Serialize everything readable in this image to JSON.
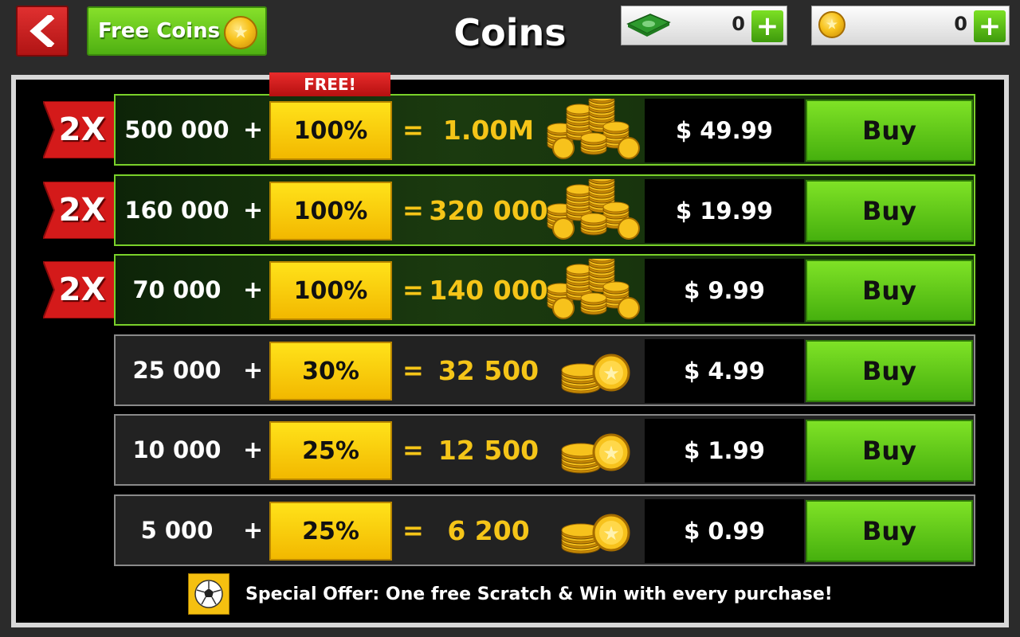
{
  "header": {
    "back_icon": "chevron-left-icon",
    "free_coins_label": "Free Coins",
    "title": "Coins",
    "cash_amount": "0",
    "coins_amount": "0",
    "plus_label": "+"
  },
  "free_tag": "FREE!",
  "packages": [
    {
      "badge": "2X",
      "base": "500 000",
      "plus": "+",
      "bonus": "100%",
      "eq": "=",
      "total": "1.00M",
      "price": "$ 49.99",
      "buy": "Buy",
      "promo": true
    },
    {
      "badge": "2X",
      "base": "160 000",
      "plus": "+",
      "bonus": "100%",
      "eq": "=",
      "total": "320 000",
      "price": "$ 19.99",
      "buy": "Buy",
      "promo": true
    },
    {
      "badge": "2X",
      "base": "70 000",
      "plus": "+",
      "bonus": "100%",
      "eq": "=",
      "total": "140 000",
      "price": "$ 9.99",
      "buy": "Buy",
      "promo": true
    },
    {
      "badge": "",
      "base": "25 000",
      "plus": "+",
      "bonus": "30%",
      "eq": "=",
      "total": "32 500",
      "price": "$ 4.99",
      "buy": "Buy",
      "promo": false
    },
    {
      "badge": "",
      "base": "10 000",
      "plus": "+",
      "bonus": "25%",
      "eq": "=",
      "total": "12 500",
      "price": "$ 1.99",
      "buy": "Buy",
      "promo": false
    },
    {
      "badge": "",
      "base": "5 000",
      "plus": "+",
      "bonus": "25%",
      "eq": "=",
      "total": "6 200",
      "price": "$ 0.99",
      "buy": "Buy",
      "promo": false
    }
  ],
  "footer": {
    "icon": "soccer-ball-icon",
    "text": "Special Offer: One free Scratch & Win with every purchase!"
  },
  "colors": {
    "accent_green": "#5cc516",
    "bonus_yellow": "#f7c800",
    "badge_red": "#d41a1a",
    "total_gold": "#f5c518"
  }
}
